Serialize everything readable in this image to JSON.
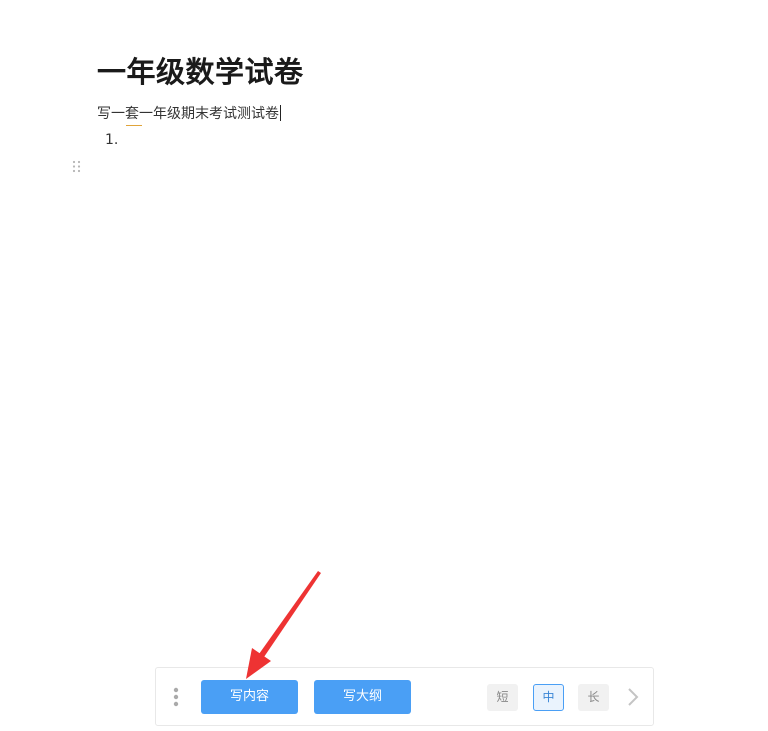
{
  "document": {
    "title": "一年级数学试卷",
    "prompt_text": "写一套一年级期末考试测试卷",
    "list_marker": "1."
  },
  "toolbar": {
    "write_content_label": "写内容",
    "write_outline_label": "写大纲",
    "length_options": {
      "short": "短",
      "medium": "中",
      "long": "长"
    },
    "selected_length": "中"
  },
  "icons": {
    "drag_handle": "drag-dots-icon",
    "more": "kebab-menu-icon",
    "next": "chevron-right-icon"
  },
  "colors": {
    "primary": "#4a9ff5",
    "annotation_arrow": "#ee3333",
    "spell_underline": "#e0a43a"
  }
}
